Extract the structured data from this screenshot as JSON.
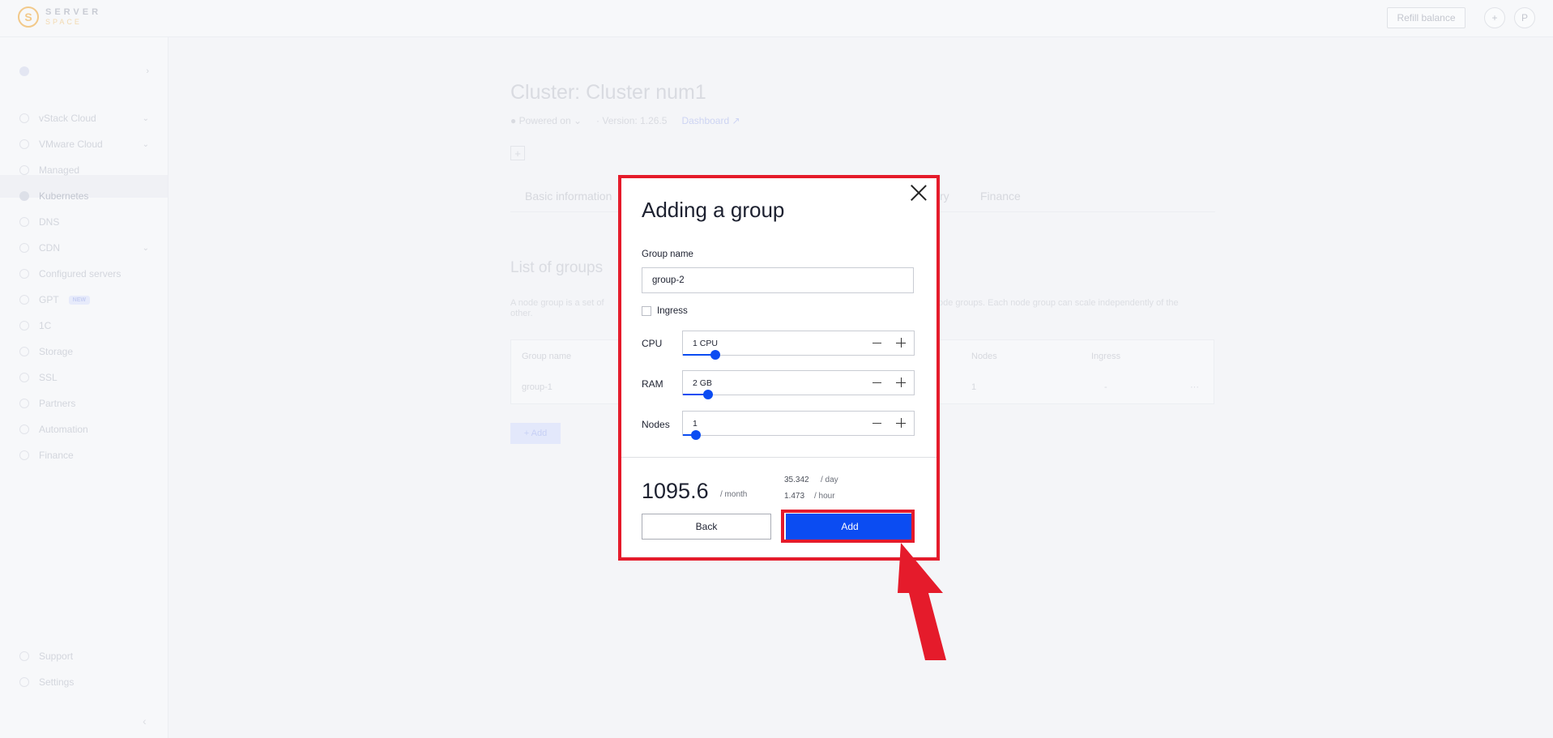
{
  "brand": {
    "line1": "SERVER",
    "line2": "SPACE",
    "mark": "S"
  },
  "header": {
    "refill_label": "Refill balance",
    "add_glyph": "+",
    "avatar_letter": "P"
  },
  "sidebar": {
    "account_caret": "›",
    "items": [
      {
        "label": "vStack Cloud",
        "chev": "⌄"
      },
      {
        "label": "VMware Cloud",
        "chev": "⌄"
      },
      {
        "label": "Managed",
        "chev": ""
      },
      {
        "label": "Kubernetes",
        "chev": ""
      },
      {
        "label": "DNS",
        "chev": ""
      },
      {
        "label": "CDN",
        "chev": "⌄"
      },
      {
        "label": "Configured servers",
        "chev": ""
      },
      {
        "label": "GPT",
        "chev": "",
        "badge": "NEW"
      },
      {
        "label": "1C",
        "chev": ""
      },
      {
        "label": "Storage",
        "chev": ""
      },
      {
        "label": "SSL",
        "chev": ""
      },
      {
        "label": "Partners",
        "chev": ""
      },
      {
        "label": "Automation",
        "chev": ""
      },
      {
        "label": "Finance",
        "chev": ""
      }
    ],
    "bottom": [
      {
        "label": "Support"
      },
      {
        "label": "Settings"
      }
    ],
    "collapse_glyph": "‹"
  },
  "background": {
    "title": "Cluster: Cluster num1",
    "status": "Powered on",
    "version": "Version: 1.26.5",
    "dashboard": "Dashboard ↗",
    "plus": "+",
    "tabs": {
      "basic": "Basic information",
      "history": "ry",
      "finance": "Finance"
    },
    "list_title": "List of groups",
    "desc_left": "A node group is a set of",
    "desc_left2": "other.",
    "desc_right": "ode groups. Each node group can scale independently of the",
    "table": {
      "col_group": "Group name",
      "col_nodes": "Nodes",
      "col_ingress": "Ingress",
      "row_group": "group-1",
      "row_nodes": "1",
      "row_ingress": "-",
      "row_menu": "···"
    },
    "add_label": "+ Add"
  },
  "modal": {
    "title": "Adding a group",
    "group_name_label": "Group name",
    "group_name_value": "group-2",
    "ingress_label": "Ingress",
    "cpu": {
      "label": "CPU",
      "value": "1 CPU",
      "fraction": 0.14
    },
    "ram": {
      "label": "RAM",
      "value": "2 GB",
      "fraction": 0.11
    },
    "nodes": {
      "label": "Nodes",
      "value": "1",
      "fraction": 0.055
    },
    "price": {
      "month_value": "1095.6",
      "month_unit": "/ month",
      "day_value": "35.342",
      "day_unit": "/ day",
      "hour_value": "1.473",
      "hour_unit": "/ hour"
    },
    "back_label": "Back",
    "add_label": "Add"
  },
  "colors": {
    "accent": "#0b4cf2",
    "highlight": "#e51b2b"
  }
}
